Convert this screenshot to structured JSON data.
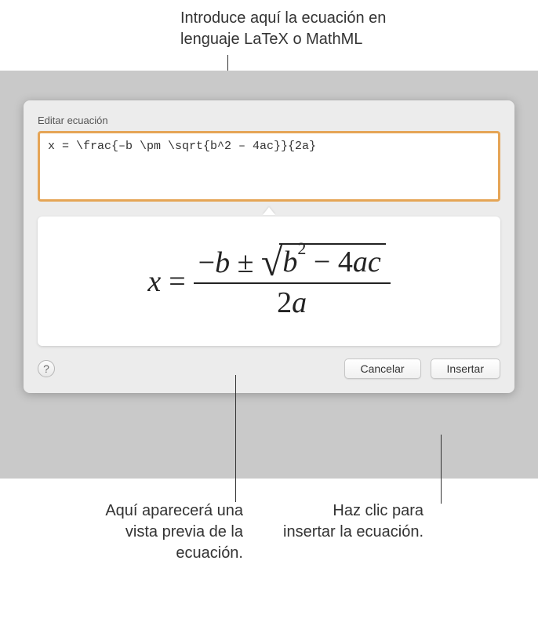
{
  "callouts": {
    "top": "Introduce aquí la ecuación en lenguaje LaTeX o MathML",
    "bottomLeft": "Aquí aparecerá una vista previa de la ecuación.",
    "bottomRight": "Haz clic para insertar la ecuación."
  },
  "dialog": {
    "title": "Editar ecuación",
    "inputValue": "x = \\frac{–b \\pm \\sqrt{b^2 – 4ac}}{2a}",
    "buttons": {
      "cancel": "Cancelar",
      "insert": "Insertar",
      "help": "?"
    }
  },
  "preview": {
    "lhs": "x",
    "equals": "=",
    "numerator_minus": "−",
    "numerator_b": "b",
    "plusminus": "±",
    "radicand_b": "b",
    "radicand_exp": "2",
    "radicand_minus": "−",
    "radicand_4ac": "4ac",
    "denominator_2": "2",
    "denominator_a": "a"
  }
}
